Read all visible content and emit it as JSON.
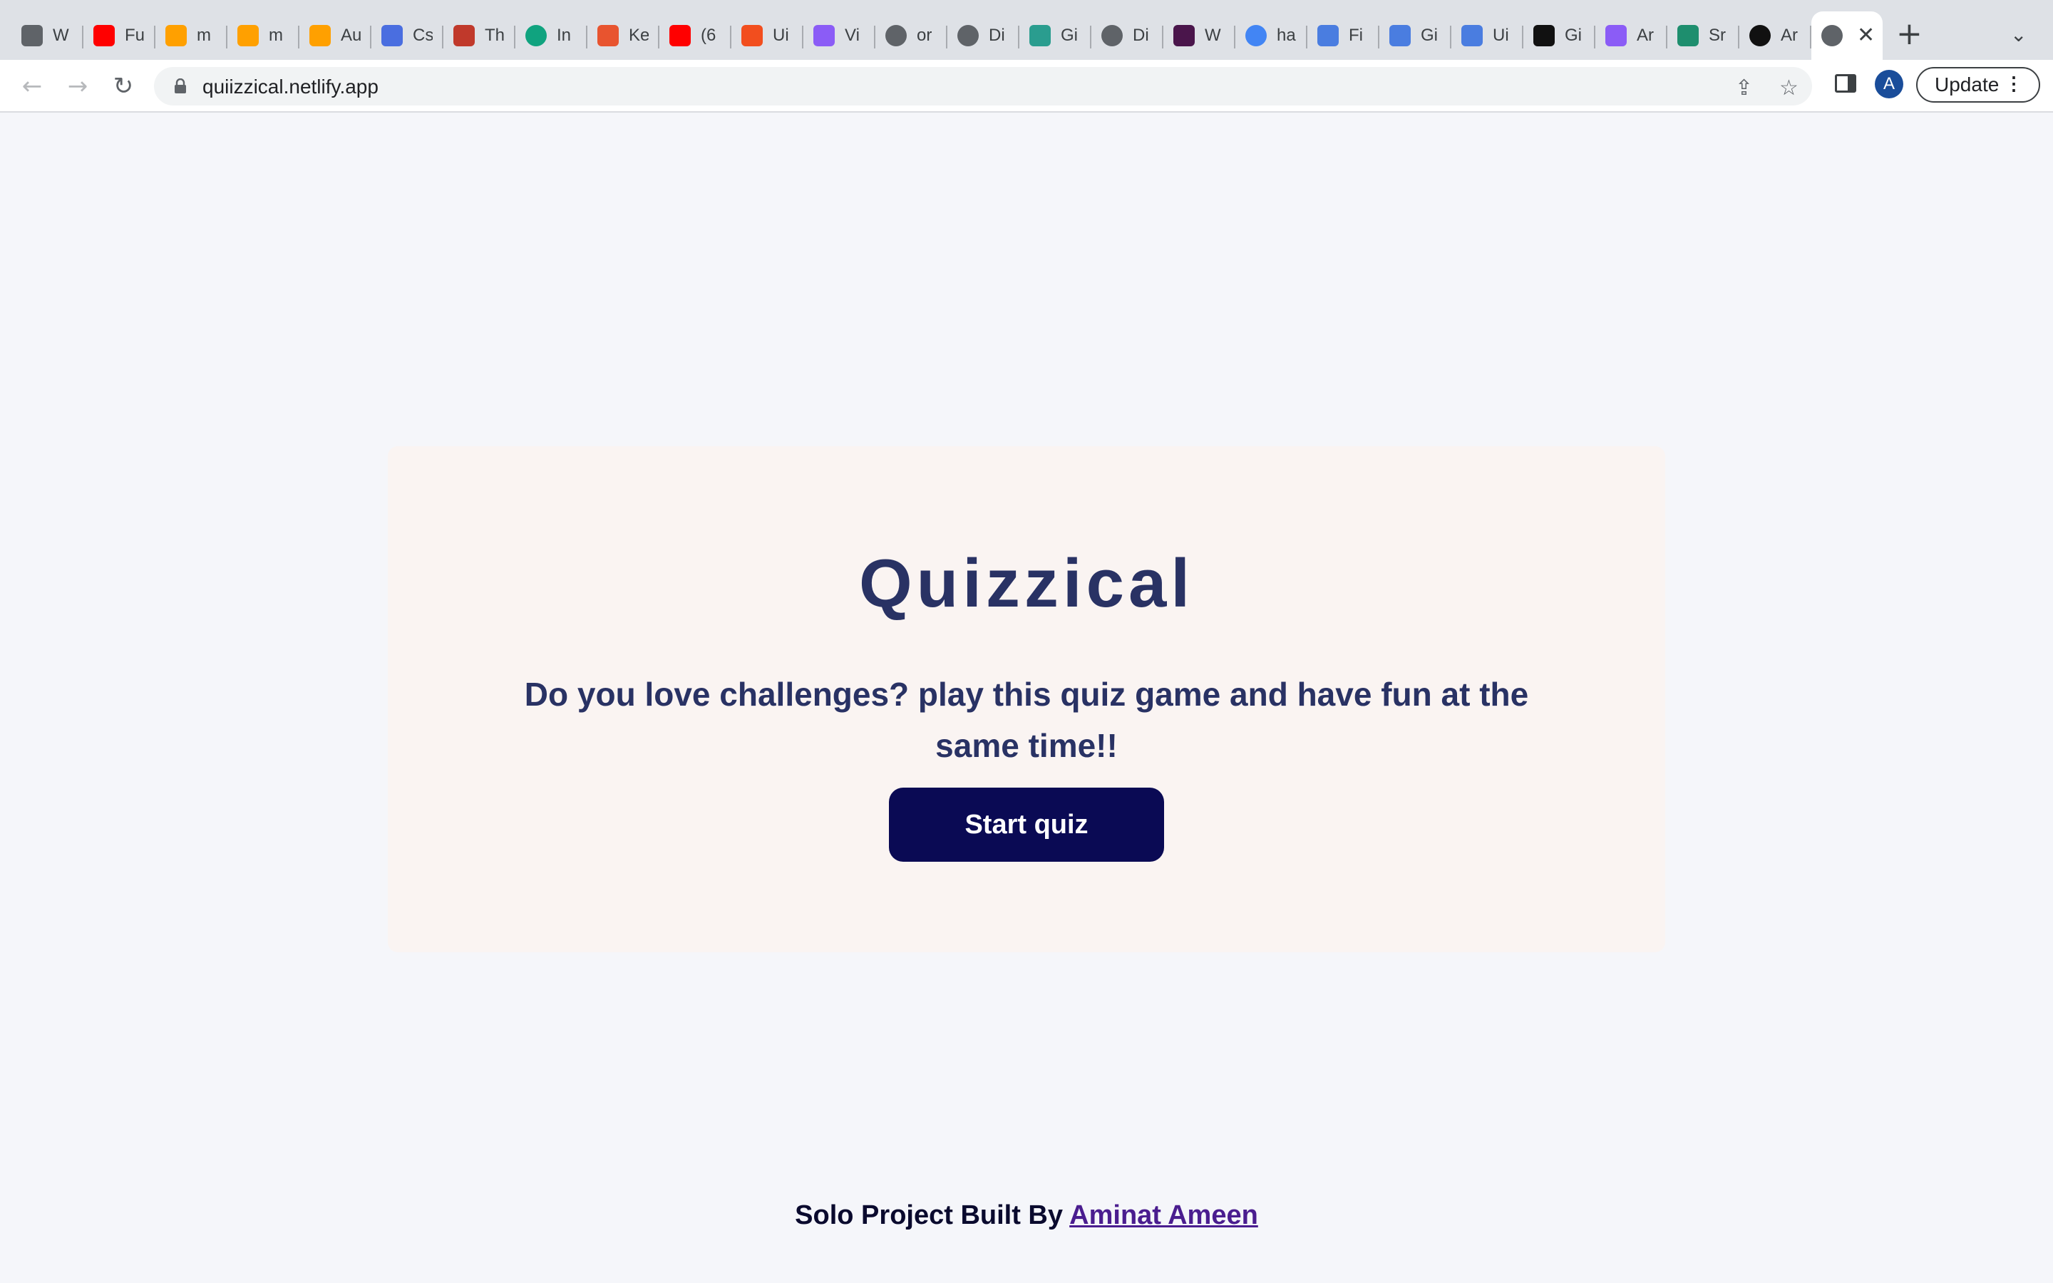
{
  "browser": {
    "tabs": [
      {
        "title": "W",
        "icon": "bookmark-icon",
        "color": "#5f6368"
      },
      {
        "title": "Fu",
        "icon": "youtube-icon",
        "color": "#ff0000"
      },
      {
        "title": "m",
        "icon": "firebase-icon",
        "color": "#ffa000"
      },
      {
        "title": "m",
        "icon": "firebase-icon",
        "color": "#ffa000"
      },
      {
        "title": "Au",
        "icon": "firebase-icon",
        "color": "#ffa000"
      },
      {
        "title": "Cs",
        "icon": "css-grid-icon",
        "color": "#4a6ee0"
      },
      {
        "title": "Th",
        "icon": "tower-icon",
        "color": "#c0392b"
      },
      {
        "title": "In",
        "icon": "openai-icon",
        "color": "#10a37f"
      },
      {
        "title": "Ke",
        "icon": "kp-icon",
        "color": "#e8542f"
      },
      {
        "title": "(6",
        "icon": "youtube-icon",
        "color": "#ff0000"
      },
      {
        "title": "Ui",
        "icon": "figma-icon",
        "color": "#f24e1e"
      },
      {
        "title": "Vi",
        "icon": "vite-icon",
        "color": "#8b5cf6"
      },
      {
        "title": "or",
        "icon": "globe-icon",
        "color": "#5f6368"
      },
      {
        "title": "Di",
        "icon": "globe-icon",
        "color": "#5f6368"
      },
      {
        "title": "Gi",
        "icon": "diamond-icon",
        "color": "#2a9d8f"
      },
      {
        "title": "Di",
        "icon": "globe-icon",
        "color": "#5f6368"
      },
      {
        "title": "W",
        "icon": "slack-icon",
        "color": "#4a154b"
      },
      {
        "title": "ha",
        "icon": "google-icon",
        "color": "#4285f4"
      },
      {
        "title": "Fi",
        "icon": "flag-icon",
        "color": "#4a7de0"
      },
      {
        "title": "Gi",
        "icon": "flag-icon",
        "color": "#4a7de0"
      },
      {
        "title": "Ui",
        "icon": "flag-icon",
        "color": "#4a7de0"
      },
      {
        "title": "Gi",
        "icon": "flag-icon",
        "color": "#111111"
      },
      {
        "title": "Ar",
        "icon": "vite-icon",
        "color": "#8b5cf6"
      },
      {
        "title": "Sr",
        "icon": "s-icon",
        "color": "#1e8e6e"
      },
      {
        "title": "Ar",
        "icon": "github-icon",
        "color": "#111111"
      }
    ],
    "active_tab": {
      "icon": "globe-icon",
      "close_label": "✕"
    },
    "new_tab_label": "+",
    "tab_menu_label": "⌄",
    "url": "quiizzical.netlify.app",
    "avatar_letter": "A",
    "update_label": "Update",
    "menu_dots": "⋮"
  },
  "page": {
    "title": "Quizzical",
    "subtitle": "Do you love challenges? play this quiz game and have fun at the same time!!",
    "start_button": "Start quiz",
    "footer_prefix": "Solo Project Built By",
    "footer_author": "Aminat Ameen"
  },
  "colors": {
    "page_bg": "#f5f6fa",
    "card_bg": "#faf4f2",
    "heading": "#293264",
    "button_bg": "#0a0a54",
    "link": "#4a1d8f"
  }
}
